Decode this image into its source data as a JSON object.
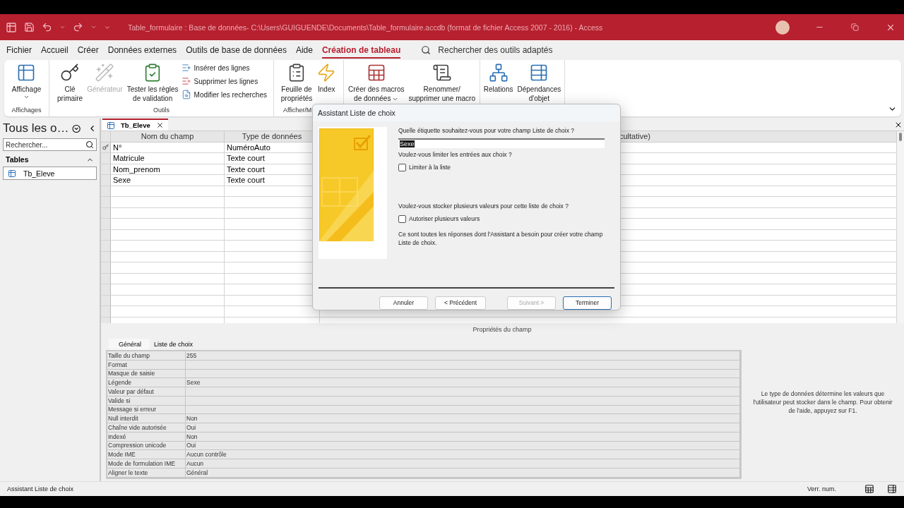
{
  "window": {
    "title": "Table_formulaire : Base de données- C:\\Users\\GUIGUENDE\\Documents\\Table_formulaire.accdb (format de fichier Access 2007 - 2016)  -  Access"
  },
  "menu": [
    {
      "label": "Fichier",
      "selected": false
    },
    {
      "label": "Accueil",
      "selected": false
    },
    {
      "label": "Créer",
      "selected": false
    },
    {
      "label": "Données externes",
      "selected": false
    },
    {
      "label": "Outils de base de données",
      "selected": false
    },
    {
      "label": "Aide",
      "selected": false
    },
    {
      "label": "Création de tableau",
      "selected": true
    }
  ],
  "search": {
    "placeholder": "Rechercher des outils adaptés"
  },
  "ribbon": [
    {
      "label": "Affichages",
      "items": [
        {
          "label": "Affichage",
          "kind": "large",
          "dropdown": true,
          "disabled": false
        }
      ]
    },
    {
      "label": "Outils",
      "items": [
        {
          "label": "Clé\nprimaire",
          "kind": "large",
          "dropdown": false,
          "disabled": false
        },
        {
          "label": "Générateur",
          "kind": "large",
          "dropdown": false,
          "disabled": true
        },
        {
          "label": "Tester les règles\nde validation",
          "kind": "large",
          "dropdown": false,
          "disabled": false
        },
        {
          "label": "Insérer des lignes",
          "kind": "small",
          "dropdown": false,
          "disabled": false
        },
        {
          "label": "Supprimer les lignes",
          "kind": "small",
          "dropdown": false,
          "disabled": false
        },
        {
          "label": "Modifier les recherches",
          "kind": "small",
          "dropdown": false,
          "disabled": false
        }
      ]
    },
    {
      "label": "Afficher/M",
      "items": [
        {
          "label": "Feuille de\npropriétés",
          "kind": "large",
          "dropdown": false,
          "disabled": false
        },
        {
          "label": "Index",
          "kind": "large",
          "dropdown": false,
          "disabled": false
        }
      ]
    },
    {
      "items": [
        {
          "label": "Créer des macros\nde données",
          "kind": "large",
          "dropdown": true,
          "disabled": false
        },
        {
          "label": "Renommer/\nsupprimer une macro",
          "kind": "large",
          "dropdown": false,
          "disabled": false
        }
      ]
    },
    {
      "items": [
        {
          "label": "Relations",
          "kind": "large",
          "dropdown": false,
          "disabled": false
        },
        {
          "label": "Dépendances\nd'objet",
          "kind": "large",
          "dropdown": false,
          "disabled": false
        }
      ]
    }
  ],
  "nav": {
    "title": "Tous les o…",
    "search": {
      "placeholder": "Rechercher..."
    },
    "groups": [
      {
        "label": "Tables",
        "expanded": true,
        "items": [
          {
            "label": "Tb_Eleve"
          }
        ]
      }
    ]
  },
  "document_tab": {
    "label": "Tb_Eleve",
    "selected": true
  },
  "table": {
    "columns": [
      "Nom du champ",
      "Type de données",
      "cultative)"
    ],
    "rows": [
      {
        "name": "N°",
        "type": "NuméroAuto",
        "primary_key": true
      },
      {
        "name": "Matricule",
        "type": "Texte court",
        "primary_key": false
      },
      {
        "name": "Nom_prenom",
        "type": "Texte court",
        "primary_key": false
      },
      {
        "name": "Sexe",
        "type": "Texte court",
        "primary_key": false
      }
    ]
  },
  "properties": {
    "title": "Propriétés du champ",
    "tabs": [
      {
        "label": "Général",
        "selected": true
      },
      {
        "label": "Liste de choix",
        "selected": false
      }
    ],
    "rows": [
      {
        "label": "Taille du champ",
        "value": "255"
      },
      {
        "label": "Format"
      },
      {
        "label": "Masque de saisie"
      },
      {
        "label": "Légende",
        "value": "Sexe"
      },
      {
        "label": "Valeur par défaut"
      },
      {
        "label": "Valide si"
      },
      {
        "label": "Message si erreur"
      },
      {
        "label": "Null interdit",
        "value": "Non"
      },
      {
        "label": "Chaîne vide autorisée",
        "value": "Oui"
      },
      {
        "label": "Indexé",
        "value": "Non"
      },
      {
        "label": "Compression unicode",
        "value": "Oui"
      },
      {
        "label": "Mode IME",
        "value": "Aucun contrôle"
      },
      {
        "label": "Mode de formulation IME",
        "value": "Aucun"
      },
      {
        "label": "Aligner le texte",
        "value": "Général"
      }
    ],
    "help": "Le type de données détermine les valeurs que l'utilisateur peut stocker dans le champ. Pour obtenir de l'aide, appuyez sur F1."
  },
  "dialog": {
    "title": "Assistant Liste de choix",
    "question_label": "Quelle étiquette souhaitez-vous pour votre champ Liste de choix ?",
    "label_value": "Sexe",
    "question_limit": "Voulez-vous limiter les entrées aux choix ?",
    "limit_checkbox": {
      "label": "Limiter à la liste",
      "checked": false
    },
    "question_multi": "Voulez-vous stocker plusieurs valeurs pour cette liste de choix ?",
    "multi_checkbox": {
      "label": "Autoriser plusieurs valeurs",
      "checked": false
    },
    "note": "Ce sont toutes les réponses dont l'Assistant a besoin pour créer votre champ Liste de choix.",
    "buttons": [
      {
        "label": "Annuler",
        "disabled": false,
        "default": false
      },
      {
        "label": "< Précédent",
        "disabled": false,
        "default": false
      },
      {
        "label": "Suivant >",
        "disabled": true,
        "default": false
      },
      {
        "label": "Terminer",
        "disabled": false,
        "default": true
      }
    ]
  },
  "status_bar": {
    "left": "Assistant Liste de choix",
    "right": "Verr. num."
  }
}
